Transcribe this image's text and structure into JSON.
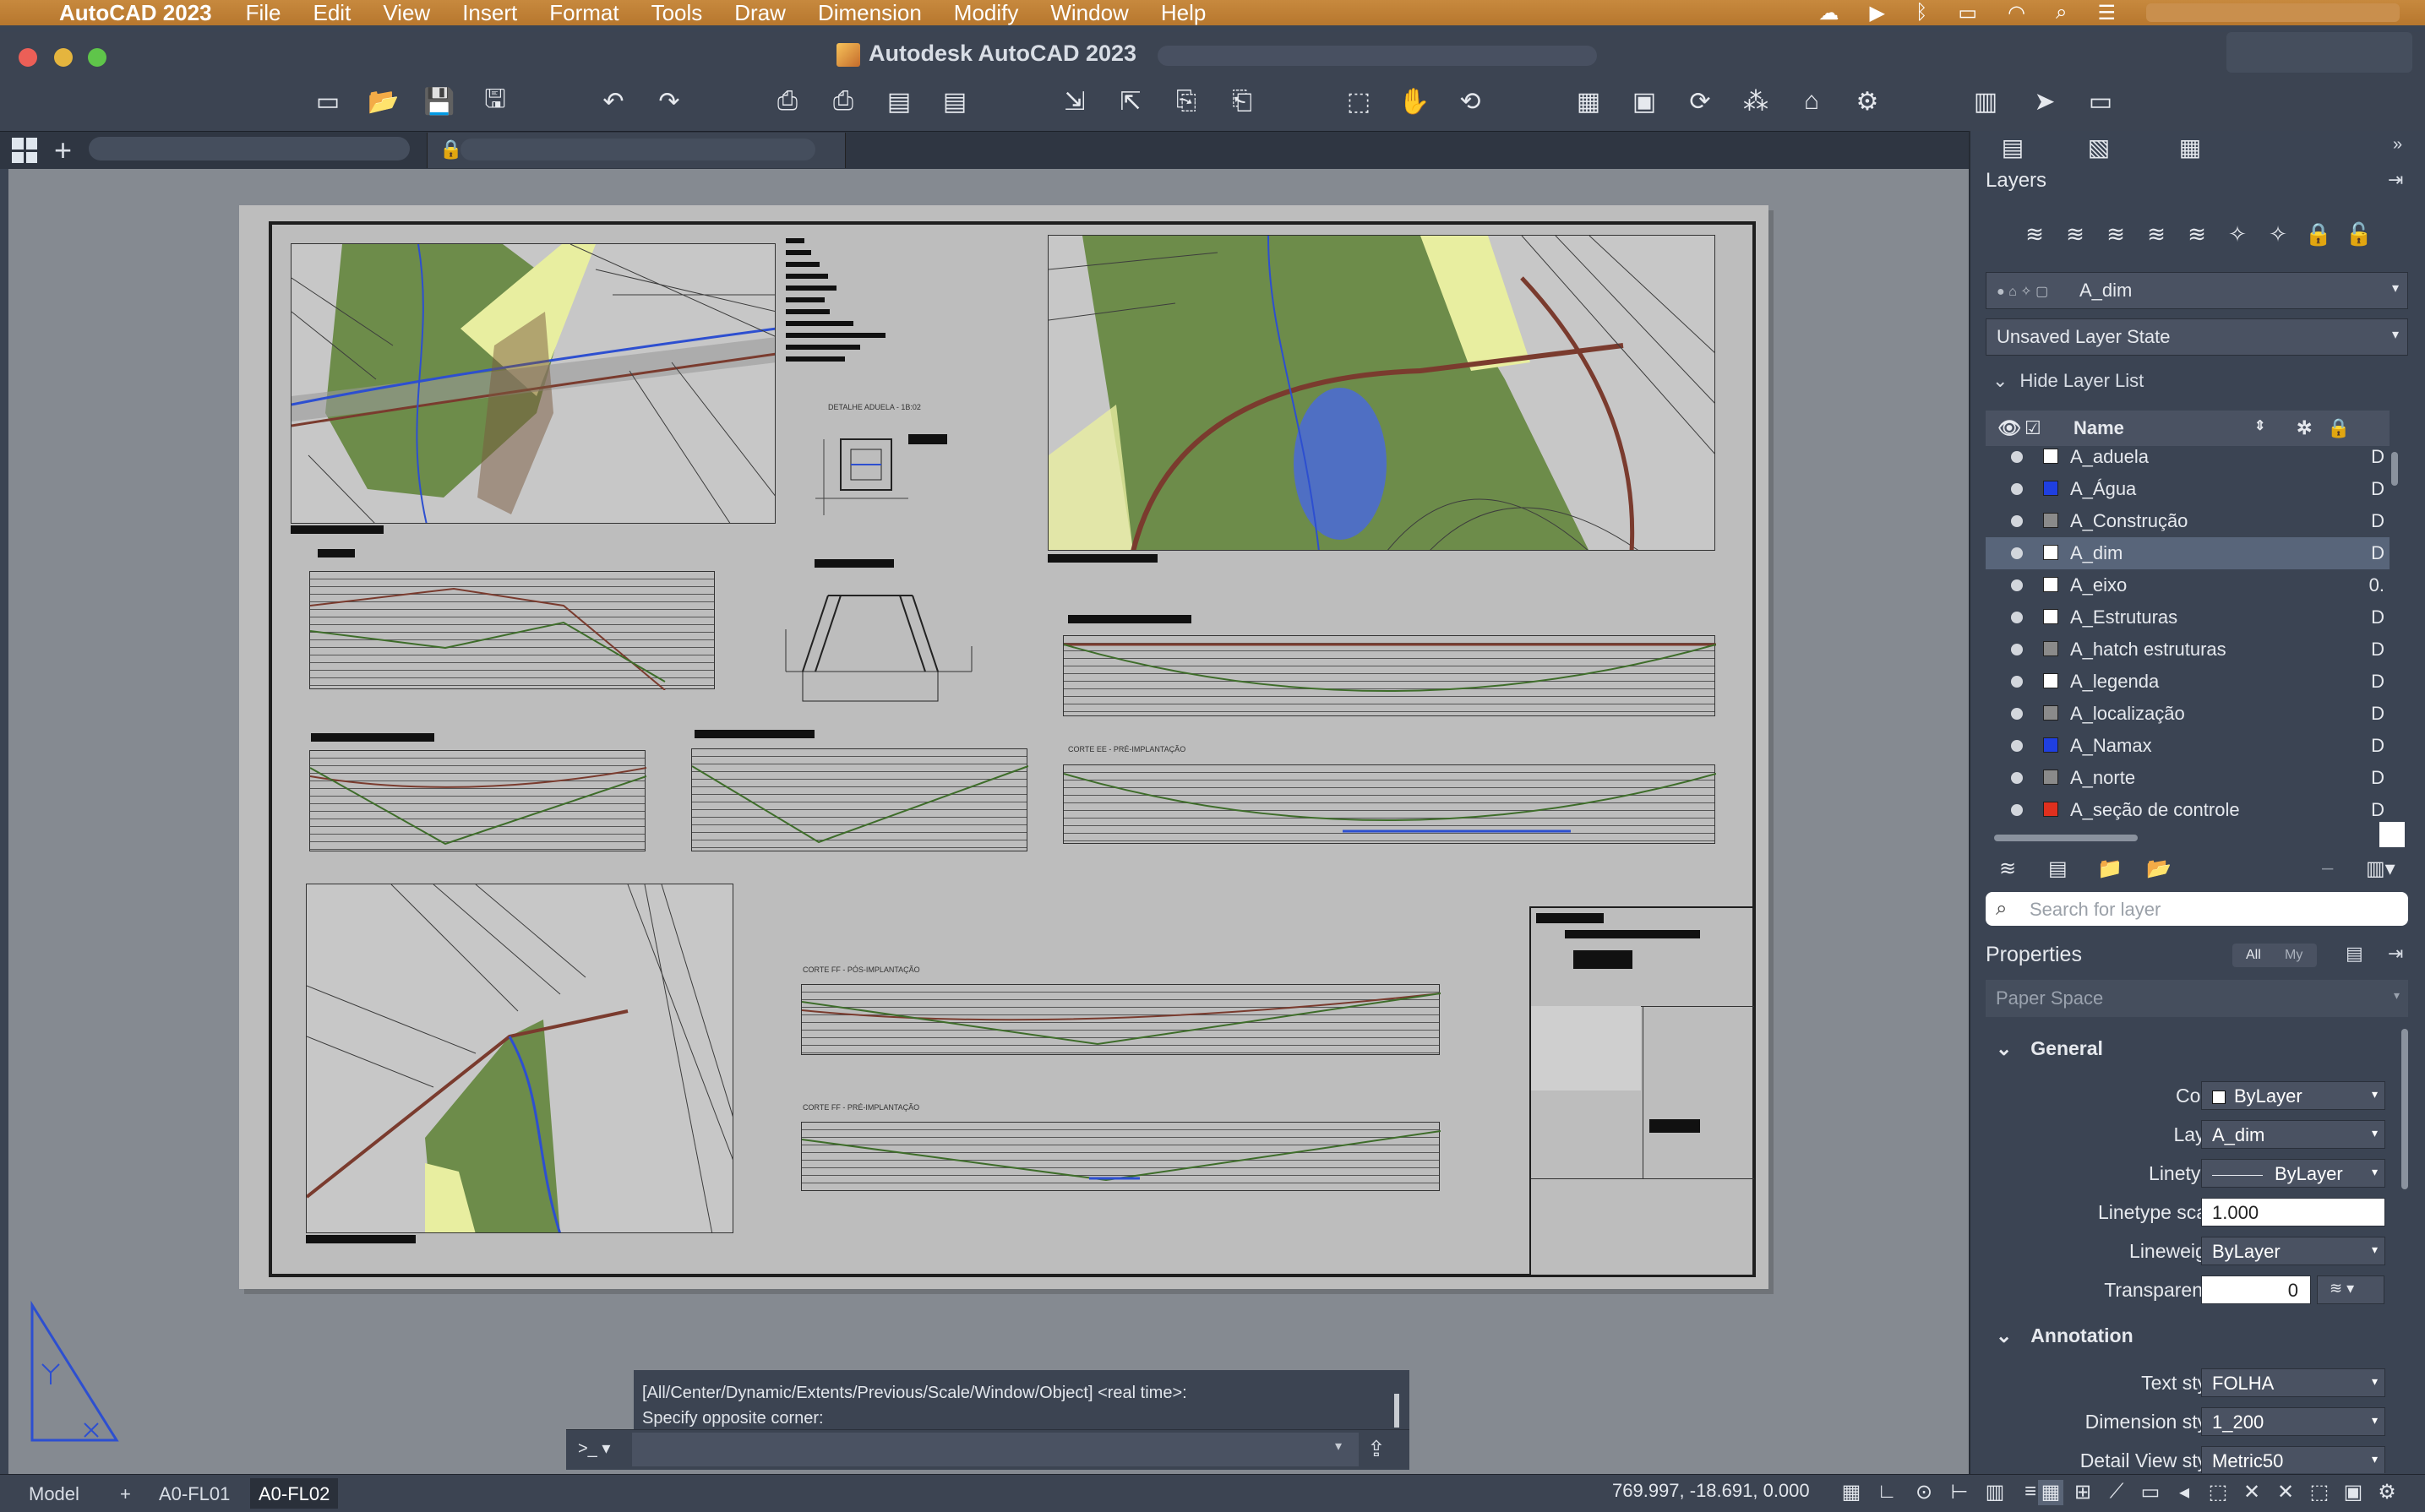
{
  "menubar": {
    "app_name": "AutoCAD 2023",
    "items": [
      "File",
      "Edit",
      "View",
      "Insert",
      "Format",
      "Tools",
      "Draw",
      "Dimension",
      "Modify",
      "Window",
      "Help"
    ]
  },
  "window": {
    "title": "Autodesk AutoCAD 2023"
  },
  "drawing": {
    "detail_caption": "DETALHE ADUELA - 1B:02",
    "corte_ee_pre": "CORTE EE - PRÉ-IMPLANTAÇÃO",
    "corte_ff_pos": "CORTE FF - PÓS-IMPLANTAÇÃO",
    "corte_ff_pre": "CORTE FF - PRÉ-IMPLANTAÇÃO"
  },
  "command_line": {
    "history": [
      "[All/Center/Dynamic/Extents/Previous/Scale/Window/Object] <real time>:",
      "Specify opposite corner:"
    ],
    "prompt": ">_ ▾"
  },
  "status_bar": {
    "tabs": [
      "Model",
      "A0-FL01",
      "A0-FL02"
    ],
    "active_tab": "A0-FL02",
    "coordinates": "769.997, -18.691, 0.000"
  },
  "layers_panel": {
    "title": "Layers",
    "current_layer": "A_dim",
    "layer_state": "Unsaved Layer State",
    "hide_list_label": "Hide Layer List",
    "column_name": "Name",
    "layers": [
      {
        "name": "A_aduela",
        "color": "#ffffff",
        "extra": "D"
      },
      {
        "name": "A_Água",
        "color": "#1f3fe0",
        "extra": "D"
      },
      {
        "name": "A_Construção",
        "color": "#8a8a8a",
        "extra": "D"
      },
      {
        "name": "A_dim",
        "color": "#ffffff",
        "extra": "D"
      },
      {
        "name": "A_eixo",
        "color": "#ffffff",
        "extra": "0."
      },
      {
        "name": "A_Estruturas",
        "color": "#ffffff",
        "extra": "D"
      },
      {
        "name": "A_hatch estruturas",
        "color": "#8a8a8a",
        "extra": "D"
      },
      {
        "name": "A_legenda",
        "color": "#ffffff",
        "extra": "D"
      },
      {
        "name": "A_localização",
        "color": "#8a8a8a",
        "extra": "D"
      },
      {
        "name": "A_Namax",
        "color": "#1f3fe0",
        "extra": "D"
      },
      {
        "name": "A_norte",
        "color": "#8a8a8a",
        "extra": "D"
      },
      {
        "name": "A_seção de controle",
        "color": "#e0301e",
        "extra": "D"
      }
    ],
    "selected_layer": "A_dim",
    "search_placeholder": "Search for layer"
  },
  "properties_panel": {
    "title": "Properties",
    "filter_all": "All",
    "filter_my": "My",
    "selection": "Paper Space",
    "general_label": "General",
    "annotation_label": "Annotation",
    "general": [
      {
        "label": "Color",
        "value": "ByLayer"
      },
      {
        "label": "Layer",
        "value": "A_dim"
      },
      {
        "label": "Linetype",
        "value": "ByLayer"
      },
      {
        "label": "Linetype scale",
        "value": "1.000"
      },
      {
        "label": "Lineweight",
        "value": "ByLayer"
      },
      {
        "label": "Transparency",
        "value": "0"
      }
    ],
    "annotation": [
      {
        "label": "Text style",
        "value": "FOLHA"
      },
      {
        "label": "Dimension style",
        "value": "1_200"
      },
      {
        "label": "Detail View style",
        "value": "Metric50"
      }
    ]
  },
  "colors": {
    "accent_menubar": "#c0813a",
    "panel_bg": "#3b4453",
    "selected_row": "#58657a"
  }
}
